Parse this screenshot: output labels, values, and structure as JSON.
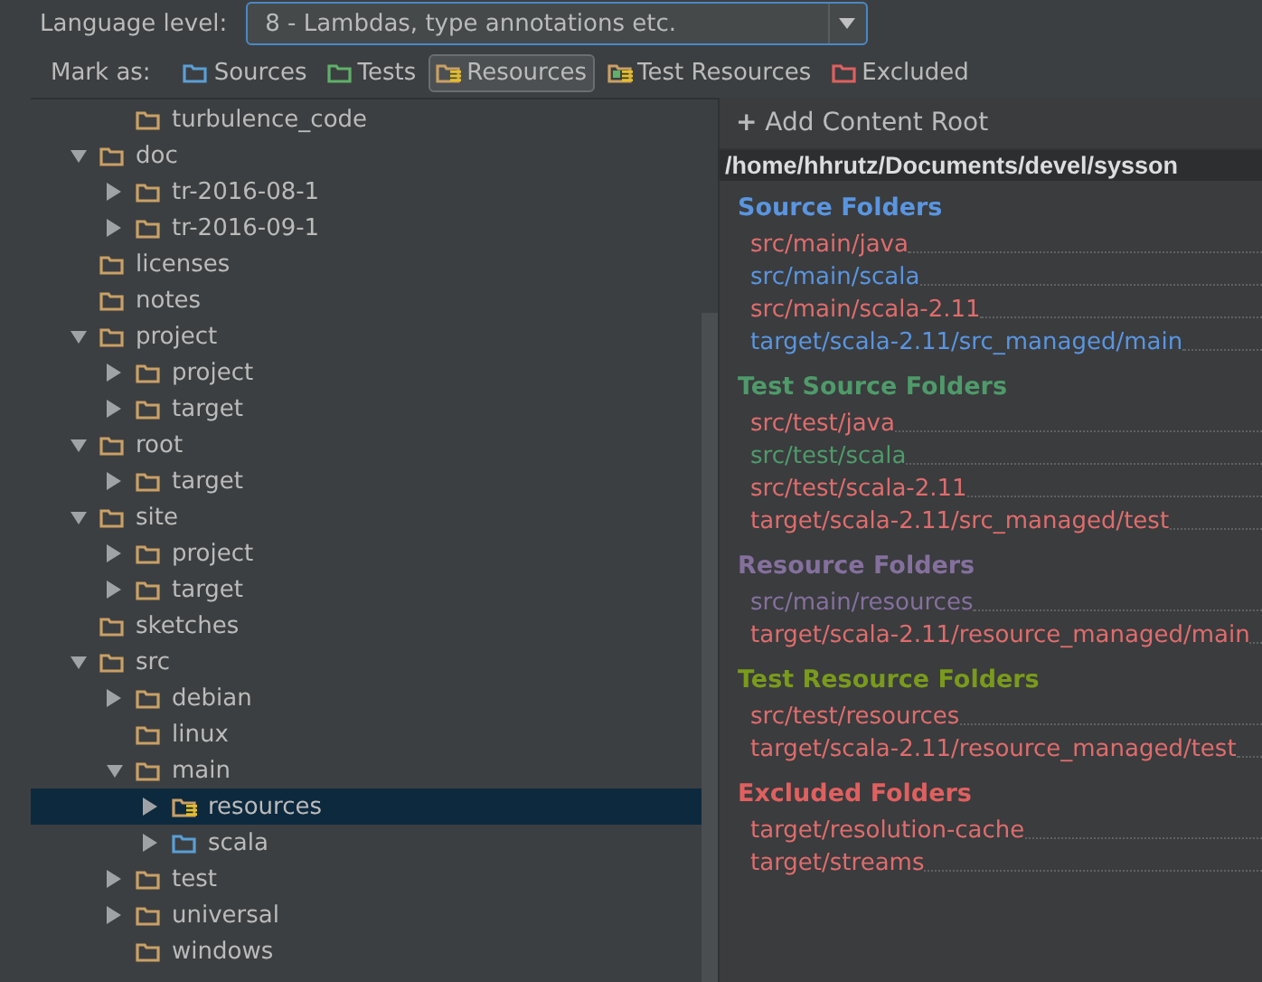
{
  "language_level": {
    "label": "Language level:",
    "value": "8 - Lambdas, type annotations etc."
  },
  "mark_as": {
    "label": "Mark as:",
    "buttons": [
      {
        "label": "Sources",
        "kind": "source",
        "selected": false
      },
      {
        "label": "Tests",
        "kind": "test",
        "selected": false
      },
      {
        "label": "Resources",
        "kind": "resources",
        "selected": true
      },
      {
        "label": "Test Resources",
        "kind": "test_resources",
        "selected": false
      },
      {
        "label": "Excluded",
        "kind": "excluded",
        "selected": false
      }
    ]
  },
  "tree": [
    {
      "children": [
        {
          "label": "turbulence_code",
          "kind": "plain",
          "selected": false
        }
      ]
    },
    {
      "label": "doc",
      "kind": "plain",
      "expanded": true,
      "selected": false,
      "children": [
        {
          "label": "tr-2016-08-1",
          "kind": "plain",
          "expanded": false,
          "selected": false
        },
        {
          "label": "tr-2016-09-1",
          "kind": "plain",
          "expanded": false,
          "selected": false
        }
      ]
    },
    {
      "label": "licenses",
      "kind": "plain",
      "selected": false
    },
    {
      "label": "notes",
      "kind": "plain",
      "selected": false
    },
    {
      "label": "project",
      "kind": "plain",
      "expanded": true,
      "selected": false,
      "children": [
        {
          "label": "project",
          "kind": "plain",
          "expanded": false,
          "selected": false
        },
        {
          "label": "target",
          "kind": "plain",
          "expanded": false,
          "selected": false
        }
      ]
    },
    {
      "label": "root",
      "kind": "plain",
      "expanded": true,
      "selected": false,
      "children": [
        {
          "label": "target",
          "kind": "plain",
          "expanded": false,
          "selected": false
        }
      ]
    },
    {
      "label": "site",
      "kind": "plain",
      "expanded": true,
      "selected": false,
      "children": [
        {
          "label": "project",
          "kind": "plain",
          "expanded": false,
          "selected": false
        },
        {
          "label": "target",
          "kind": "plain",
          "expanded": false,
          "selected": false
        }
      ]
    },
    {
      "label": "sketches",
      "kind": "plain",
      "selected": false
    },
    {
      "label": "src",
      "kind": "plain",
      "expanded": true,
      "selected": false,
      "children": [
        {
          "label": "debian",
          "kind": "plain",
          "expanded": false,
          "selected": false
        },
        {
          "label": "linux",
          "kind": "plain",
          "selected": false
        },
        {
          "label": "main",
          "kind": "plain",
          "expanded": true,
          "selected": false,
          "children": [
            {
              "label": "resources",
              "kind": "resources",
              "expanded": false,
              "selected": true
            },
            {
              "label": "scala",
              "kind": "source",
              "expanded": false,
              "selected": false
            }
          ]
        },
        {
          "label": "test",
          "kind": "plain",
          "expanded": false,
          "selected": false
        },
        {
          "label": "universal",
          "kind": "plain",
          "expanded": false,
          "selected": false
        },
        {
          "label": "windows",
          "kind": "plain",
          "selected": false
        }
      ]
    }
  ],
  "content_root": {
    "add_button": "Add Content Root",
    "add_icon": "+",
    "path": "/home/hhrutz/Documents/devel/sysson",
    "sections": [
      {
        "title": "Source Folders",
        "color": "#5a95e0",
        "entries": [
          {
            "path": "src/main/java",
            "missing": true
          },
          {
            "path": "src/main/scala",
            "missing": false
          },
          {
            "path": "src/main/scala-2.11",
            "missing": true
          },
          {
            "path": "target/scala-2.11/src_managed/main",
            "missing": false
          }
        ]
      },
      {
        "title": "Test Source Folders",
        "color": "#4f9a6a",
        "entries": [
          {
            "path": "src/test/java",
            "missing": true
          },
          {
            "path": "src/test/scala",
            "missing": false
          },
          {
            "path": "src/test/scala-2.11",
            "missing": true
          },
          {
            "path": "target/scala-2.11/src_managed/test",
            "missing": true
          }
        ]
      },
      {
        "title": "Resource Folders",
        "color": "#85709d",
        "entries": [
          {
            "path": "src/main/resources",
            "missing": false
          },
          {
            "path": "target/scala-2.11/resource_managed/main",
            "missing": true
          }
        ]
      },
      {
        "title": "Test Resource Folders",
        "color": "#7a9a1c",
        "entries": [
          {
            "path": "src/test/resources",
            "missing": true
          },
          {
            "path": "target/scala-2.11/resource_managed/test",
            "missing": true
          }
        ]
      },
      {
        "title": "Excluded Folders",
        "color": "#e0605f",
        "entries": [
          {
            "path": "target/resolution-cache",
            "missing": true
          },
          {
            "path": "target/streams",
            "missing": true
          }
        ]
      }
    ]
  }
}
